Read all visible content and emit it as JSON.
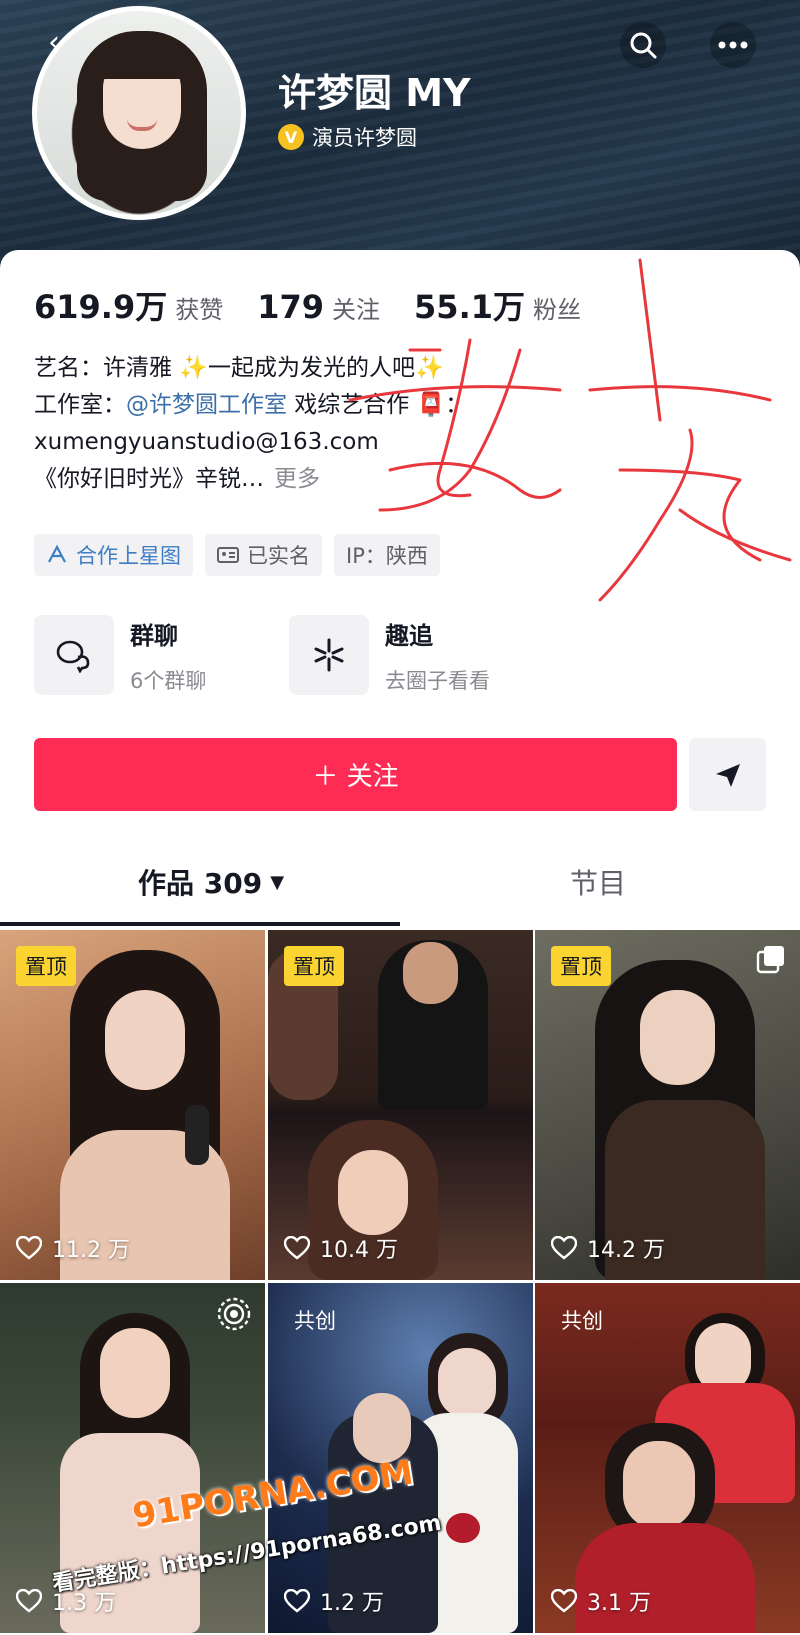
{
  "profile": {
    "name": "许梦圆 MY",
    "verification": "演员许梦圆",
    "verify_badge": "V"
  },
  "stats": [
    {
      "value": "619.9万",
      "label": "获赞"
    },
    {
      "value": "179",
      "label": "关注"
    },
    {
      "value": "55.1万",
      "label": "粉丝"
    }
  ],
  "bio": {
    "line1": "艺名：许清雅 ✨一起成为发光的人吧✨",
    "line2_prefix": "工作室：",
    "line2_link": "@许梦圆工作室",
    "line2_suffix": " 戏综艺合作 📮：",
    "line3": "xumengyuanstudio@163.com",
    "line4": "《你好旧时光》辛锐…",
    "more": "更多"
  },
  "tags": [
    {
      "label": "合作上星图",
      "icon": "star-map-icon"
    },
    {
      "label": "已实名",
      "icon": "id-card-icon"
    },
    {
      "label": "IP：陕西",
      "icon": ""
    }
  ],
  "features": [
    {
      "title": "群聊",
      "subtitle": "6个群聊",
      "icon": "chat-bubbles-icon"
    },
    {
      "title": "趣追",
      "subtitle": "去圈子看看",
      "icon": "sparkle-icon"
    }
  ],
  "actions": {
    "follow_label": "＋ 关注"
  },
  "tabs": {
    "works": "作品 309",
    "shows": "节目"
  },
  "videos": [
    {
      "badge": "置顶",
      "likes": "11.2 万"
    },
    {
      "badge": "置顶",
      "likes": "10.4 万"
    },
    {
      "badge": "置顶",
      "likes": "14.2 万"
    },
    {
      "badge": "",
      "likes": "1.3 万"
    },
    {
      "badge": "共创",
      "likes": "1.2 万"
    },
    {
      "badge": "共创",
      "likes": "3.1 万"
    }
  ],
  "watermark": {
    "logo": "91PORNA.COM",
    "url": "看完整版：https://91porna68.com"
  },
  "colors": {
    "follow": "#fe2c55",
    "pin_badge": "#fbd431",
    "link": "#3d6fa8",
    "scribble": "#e8383d"
  }
}
